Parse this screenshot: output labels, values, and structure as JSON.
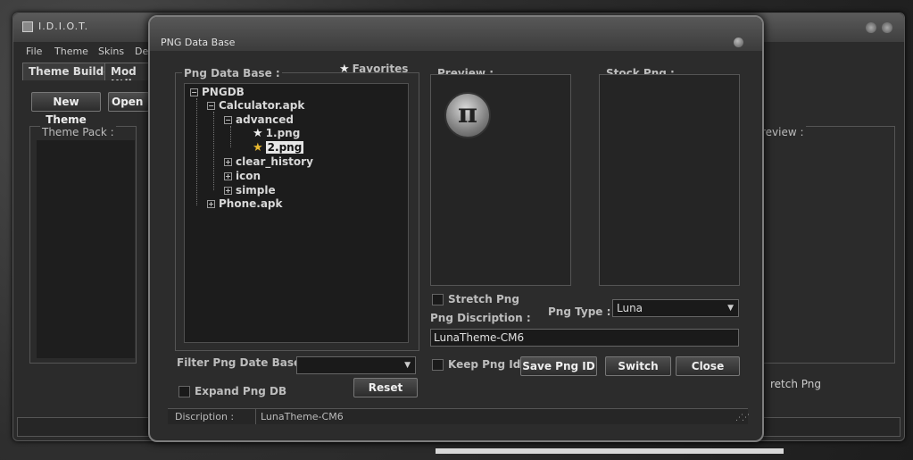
{
  "main_window": {
    "title": "I.D.I.O.T.",
    "menu": [
      "File",
      "Theme",
      "Skins",
      "Debu"
    ],
    "tabs": [
      "Theme Builder",
      "Mod Utils"
    ],
    "buttons": {
      "new_theme": "New Theme",
      "open_theme": "Open The"
    },
    "theme_pack_label": "Theme Pack :",
    "right_preview_label": "review :",
    "right_stretch_label": "retch Png"
  },
  "dialog": {
    "title": "PNG Data Base",
    "tree_group_label": "Png Data Base :",
    "favorites_label": "Favorites",
    "tree": {
      "root": "PNGDB",
      "calculator": "Calculator.apk",
      "advanced": "advanced",
      "file1": "1.png",
      "file2": "2.png",
      "clear_history": "clear_history",
      "icon": "icon",
      "simple": "simple",
      "phone": "Phone.apk"
    },
    "preview_label": "Preview :",
    "stock_label": "Stock Png :",
    "preview_glyph": "π",
    "stretch_label": "Stretch Png",
    "png_type_label": "Png Type :",
    "png_type_value": "Luna",
    "description_label": "Png Discription :",
    "description_value": "LunaTheme-CM6",
    "filter_label": "Filter Png Date Base :",
    "filter_value": "",
    "expand_label": "Expand Png DB",
    "reset_button": "Reset",
    "keep_id_label": "Keep Png Id",
    "save_button": "Save Png ID",
    "switch_button": "Switch",
    "close_button": "Close",
    "status_label": "Discription :",
    "status_value": "LunaTheme-CM6"
  }
}
